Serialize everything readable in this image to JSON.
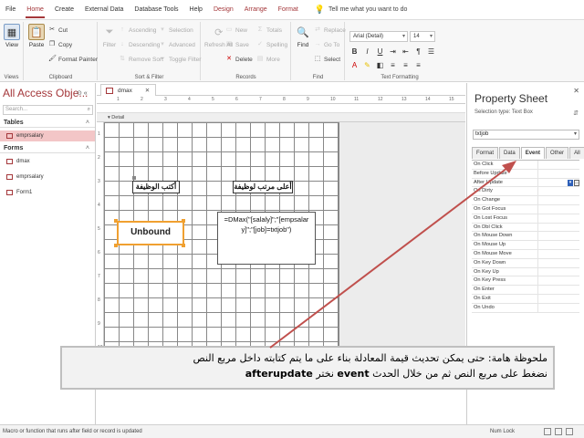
{
  "menubar": {
    "tabs": [
      "File",
      "Home",
      "Create",
      "External Data",
      "Database Tools",
      "Help"
    ],
    "context_tabs": [
      "Design",
      "Arrange",
      "Format"
    ],
    "tell_me": "Tell me what you want to do",
    "accent": "#a4373a"
  },
  "ribbon": {
    "views": {
      "view_label": "View",
      "group_label": "Views"
    },
    "clipboard": {
      "paste": "Paste",
      "cut": "Cut",
      "copy": "Copy",
      "format_painter": "Format Painter",
      "group_label": "Clipboard"
    },
    "sortfilter": {
      "filter": "Filter",
      "ascending": "Ascending",
      "descending": "Descending",
      "remove_sort": "Remove Sort",
      "selection": "Selection",
      "advanced": "Advanced",
      "toggle_filter": "Toggle Filter",
      "group_label": "Sort & Filter"
    },
    "records": {
      "refresh": "Refresh All",
      "new": "New",
      "save": "Save",
      "delete": "Delete",
      "totals": "Totals",
      "spelling": "Spelling",
      "more": "More",
      "group_label": "Records"
    },
    "find": {
      "find": "Find",
      "replace": "Replace",
      "goto": "Go To",
      "select": "Select",
      "group_label": "Find"
    },
    "textformat": {
      "font": "Arial (Detail)",
      "size": "14",
      "group_label": "Text Formatting"
    }
  },
  "navpane": {
    "title": "All Access Obje...",
    "search_placeholder": "Search...",
    "tables_header": "Tables",
    "tables": [
      "emprsalary"
    ],
    "forms_header": "Forms",
    "forms": [
      "dmax",
      "emprsalary",
      "Form1"
    ]
  },
  "document": {
    "tab_name": "dmax",
    "section_name": "Detail",
    "ruler_top": [
      "1",
      "2",
      "3",
      "4",
      "5",
      "6",
      "7",
      "8",
      "9",
      "10",
      "11",
      "12",
      "13",
      "14",
      "15"
    ],
    "ruler_left": [
      "1",
      "2",
      "3",
      "4",
      "5",
      "6",
      "7",
      "8",
      "9",
      "10"
    ],
    "label1": "أكتب الوظيفة",
    "label2": "أعلى مرتب لوظيفة",
    "unbound_text": "Unbound",
    "formula_text": "=DMax(\"[salaly]\";\"[empsalary]\";\"[job]=txtjob\")"
  },
  "propsheet": {
    "title": "Property Sheet",
    "selection_type": "Selection type: Text Box",
    "object": "txtjob",
    "tabs": [
      "Format",
      "Data",
      "Event",
      "Other",
      "All"
    ],
    "active_tab": "Event",
    "properties": [
      "On Click",
      "Before Update",
      "After Update",
      "On Dirty",
      "On Change",
      "On Got Focus",
      "On Lost Focus",
      "On Dbl Click",
      "On Mouse Down",
      "On Mouse Up",
      "On Mouse Move",
      "On Key Down",
      "On Key Up",
      "On Key Press",
      "On Enter",
      "On Exit",
      "On Undo"
    ]
  },
  "annotation": {
    "line1": "ملحوظة هامة: حتى يمكن تحديث قيمة المعادلة بناء على ما يتم كتابته داخل مربع النص",
    "line2_a": "نضغط على مربع النص ثم من خلال الحدث",
    "line2_event": "event",
    "line2_b": "نختر",
    "line2_prop": "afterupdate",
    "arrow_color": "#c0504d"
  },
  "statusbar": {
    "message": "Macro or function that runs after field or record is updated",
    "numlock": "Num Lock"
  }
}
